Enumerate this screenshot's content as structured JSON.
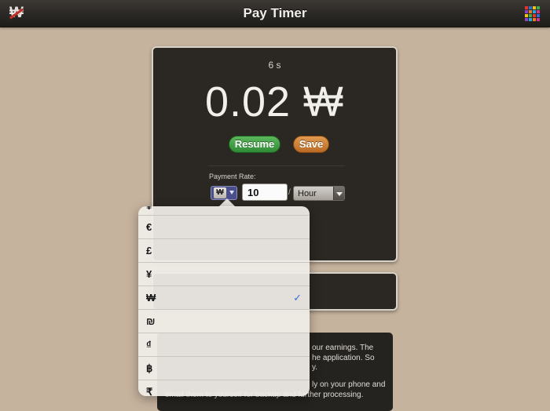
{
  "header": {
    "title": "Pay Timer",
    "logo_symbol": "₩",
    "grid_colors": [
      "#e8342b",
      "#2e6fd6",
      "#f4c21c",
      "#3bb04a",
      "#8b3fc9",
      "#ee7a1e",
      "#26a9e0",
      "#d6338a",
      "#f4c21c",
      "#3bb04a",
      "#e8342b",
      "#2e6fd6",
      "#8b3fc9",
      "#26a9e0",
      "#ee7a1e",
      "#d6338a"
    ]
  },
  "timer": {
    "elapsed": "6 s",
    "amount": "0.02 ₩",
    "resume_label": "Resume",
    "save_label": "Save"
  },
  "rate": {
    "label": "Payment Rate:",
    "currency": "₩",
    "value": "10",
    "separator": "/",
    "unit": "Hour"
  },
  "info": {
    "lines": [
      "our earnings. The",
      "he application. So",
      "y.",
      "ly on your phone and",
      "email them to yourself for backup and further processing."
    ]
  },
  "currency_menu": {
    "items": [
      {
        "symbol": "€",
        "selected": false
      },
      {
        "symbol": "£",
        "selected": false
      },
      {
        "symbol": "¥",
        "selected": false
      },
      {
        "symbol": "₩",
        "selected": true
      },
      {
        "symbol": "₪",
        "selected": false
      },
      {
        "symbol": "₫",
        "selected": false
      },
      {
        "symbol": "฿",
        "selected": false
      },
      {
        "symbol": "₹",
        "selected": false
      }
    ],
    "check_mark": "✓"
  }
}
